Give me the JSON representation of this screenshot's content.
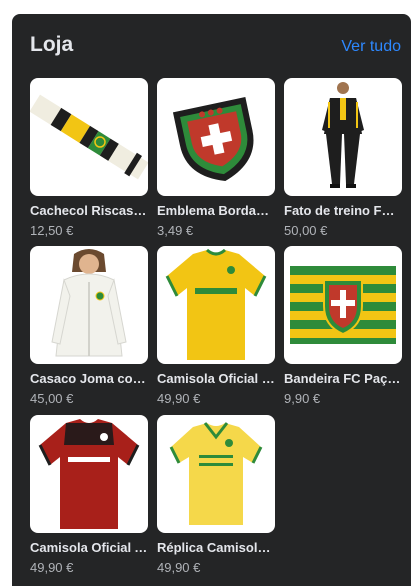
{
  "shop": {
    "title": "Loja",
    "see_all": "Ver tudo",
    "products": [
      {
        "name": "Cachecol Riscas FC Paços de Ferreira",
        "price": "12,50 €",
        "icon": "scarf-icon"
      },
      {
        "name": "Emblema Bordado FC Paços de Ferreira",
        "price": "3,49 €",
        "icon": "badge-icon"
      },
      {
        "name": "Fato de treino FC Paços de Ferreira",
        "price": "50,00 €",
        "icon": "tracksuit-icon"
      },
      {
        "name": "Casaco Joma com capuz",
        "price": "45,00 €",
        "icon": "hoodie-icon"
      },
      {
        "name": "Camisola Oficial Principal",
        "price": "49,90 €",
        "icon": "yellow-jersey-icon"
      },
      {
        "name": "Bandeira FC Paços de Ferreira",
        "price": "9,90 €",
        "icon": "flag-icon"
      },
      {
        "name": "Camisola Oficial Alternativa",
        "price": "49,90 €",
        "icon": "red-jersey-icon"
      },
      {
        "name": "Réplica Camisola Capital do Móvel",
        "price": "49,90 €",
        "icon": "retro-jersey-icon"
      }
    ]
  },
  "colors": {
    "panel_bg": "#242526",
    "title_text": "#e4e6eb",
    "link": "#2d88ff",
    "price_text": "#b0b3b8",
    "club_yellow": "#f2c514",
    "club_green": "#2e8b3a"
  }
}
